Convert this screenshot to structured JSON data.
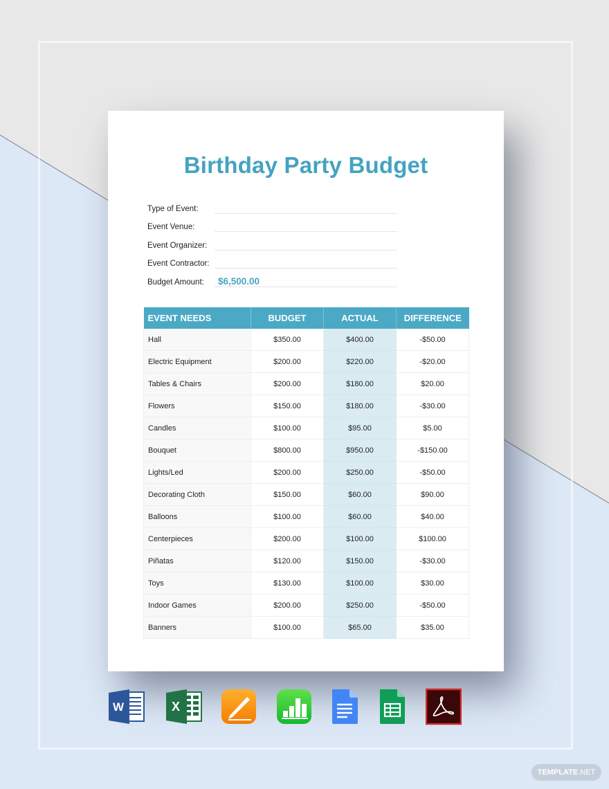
{
  "document": {
    "title": "Birthday Party Budget",
    "fields": [
      {
        "label": "Type of Event:",
        "value": ""
      },
      {
        "label": "Event Venue:",
        "value": ""
      },
      {
        "label": "Event Organizer:",
        "value": ""
      },
      {
        "label": "Event Contractor:",
        "value": ""
      },
      {
        "label": "Budget Amount:",
        "value": "$6,500.00"
      }
    ],
    "table": {
      "headers": [
        "EVENT NEEDS",
        "BUDGET",
        "ACTUAL",
        "DIFFERENCE"
      ],
      "rows": [
        {
          "need": "Hall",
          "budget": "$350.00",
          "actual": "$400.00",
          "difference": "-$50.00"
        },
        {
          "need": "Electric Equipment",
          "budget": "$200.00",
          "actual": "$220.00",
          "difference": "-$20.00"
        },
        {
          "need": "Tables & Chairs",
          "budget": "$200.00",
          "actual": "$180.00",
          "difference": "$20.00"
        },
        {
          "need": "Flowers",
          "budget": "$150.00",
          "actual": "$180.00",
          "difference": "-$30.00"
        },
        {
          "need": "Candles",
          "budget": "$100.00",
          "actual": "$95.00",
          "difference": "$5.00"
        },
        {
          "need": "Bouquet",
          "budget": "$800.00",
          "actual": "$950.00",
          "difference": "-$150.00"
        },
        {
          "need": "Lights/Led",
          "budget": "$200.00",
          "actual": "$250.00",
          "difference": "-$50.00"
        },
        {
          "need": "Decorating Cloth",
          "budget": "$150.00",
          "actual": "$60.00",
          "difference": "$90.00"
        },
        {
          "need": "Balloons",
          "budget": "$100.00",
          "actual": "$60.00",
          "difference": "$40.00"
        },
        {
          "need": "Centerpieces",
          "budget": "$200.00",
          "actual": "$100.00",
          "difference": "$100.00"
        },
        {
          "need": "Piñatas",
          "budget": "$120.00",
          "actual": "$150.00",
          "difference": "-$30.00"
        },
        {
          "need": "Toys",
          "budget": "$130.00",
          "actual": "$100.00",
          "difference": "$30.00"
        },
        {
          "need": "Indoor Games",
          "budget": "$200.00",
          "actual": "$250.00",
          "difference": "-$50.00"
        },
        {
          "need": "Banners",
          "budget": "$100.00",
          "actual": "$65.00",
          "difference": "$35.00"
        }
      ]
    }
  },
  "format_icons": [
    {
      "name": "microsoft-word-icon",
      "letter": "W",
      "color": "#2b579a"
    },
    {
      "name": "microsoft-excel-icon",
      "letter": "X",
      "color": "#217346"
    },
    {
      "name": "apple-pages-icon",
      "color": "#f7941d"
    },
    {
      "name": "apple-numbers-icon",
      "color": "#34c43a"
    },
    {
      "name": "google-docs-icon",
      "color": "#4285f4"
    },
    {
      "name": "google-sheets-icon",
      "color": "#0f9d58"
    },
    {
      "name": "adobe-pdf-icon",
      "color": "#3a0a0a"
    }
  ],
  "watermark": {
    "brand": "TEMPLATE",
    "suffix": ".NET"
  },
  "colors": {
    "title": "#45a3c0",
    "header": "#4ba9c6",
    "actual_column": "#daecf2",
    "budget_amount": "#4ba3c3"
  }
}
